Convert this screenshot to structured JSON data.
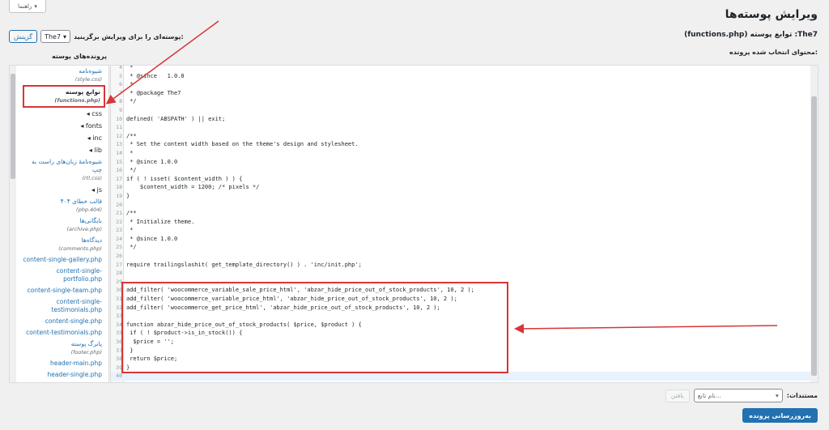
{
  "help_tab": {
    "label": "راهنما",
    "arrow": "▾"
  },
  "title": "ویرایش پوسته‌ها",
  "file_heading": {
    "theme": "The7",
    "rest": ": توابع پوسته (functions.php)"
  },
  "theme_select": {
    "label": "پوسته‌ای را برای ویرایش برگزینید:",
    "value": "The7",
    "button": "گزینش"
  },
  "selected_content_label": "محتوای انتخاب شده پرونده:",
  "files_heading": "پرونده‌های پوسته",
  "sidebar": [
    {
      "type": "file",
      "name": "شیوه‌نامه",
      "file": "(style.css)"
    },
    {
      "type": "file",
      "name": "توابع پوسته",
      "file": "(functions.php)",
      "active": true
    },
    {
      "type": "folder",
      "name": "css"
    },
    {
      "type": "folder",
      "name": "fonts"
    },
    {
      "type": "folder",
      "name": "inc"
    },
    {
      "type": "folder",
      "name": "lib"
    },
    {
      "type": "file",
      "name": "شیوه‌نامهٔ زبان‌های راست به چپ",
      "file": "(rtl.css)"
    },
    {
      "type": "folder",
      "name": "js"
    },
    {
      "type": "file",
      "name": "قالب خطای ۴۰۴",
      "file": "(php.404)"
    },
    {
      "type": "file",
      "name": "بایگانی‌ها",
      "file": "(archive.php)"
    },
    {
      "type": "file",
      "name": "دیدگاه‌ها",
      "file": "(comments.php)"
    },
    {
      "type": "file",
      "name": "content-single-gallery.php"
    },
    {
      "type": "file",
      "name": "content-single-portfolio.php"
    },
    {
      "type": "file",
      "name": "content-single-team.php"
    },
    {
      "type": "file",
      "name": "content-single-testimonials.php"
    },
    {
      "type": "file",
      "name": "content-single.php"
    },
    {
      "type": "file",
      "name": "content-testimonials.php"
    },
    {
      "type": "file",
      "name": "پانرگ پوسته",
      "file": "(footer.php)"
    },
    {
      "type": "file",
      "name": "header-main.php"
    },
    {
      "type": "file",
      "name": "header-single.php"
    }
  ],
  "code_lines": [
    {
      "n": "4",
      "t": " *",
      "c": "com"
    },
    {
      "n": "5",
      "t": " * @since   1.0.0",
      "c": "com"
    },
    {
      "n": "6",
      "t": " *",
      "c": "com"
    },
    {
      "n": "7",
      "t": " * @package The7",
      "c": "com"
    },
    {
      "n": "8",
      "t": " */",
      "c": "com"
    },
    {
      "n": "9",
      "t": "",
      "c": ""
    },
    {
      "n": "10",
      "t": "defined( 'ABSPATH' ) || exit;",
      "c": ""
    },
    {
      "n": "11",
      "t": "",
      "c": ""
    },
    {
      "n": "12",
      "t": "/**",
      "c": "com"
    },
    {
      "n": "13",
      "t": " * Set the content width based on the theme's design and stylesheet.",
      "c": "com"
    },
    {
      "n": "14",
      "t": " *",
      "c": "com"
    },
    {
      "n": "15",
      "t": " * @since 1.0.0",
      "c": "com"
    },
    {
      "n": "16",
      "t": " */",
      "c": "com"
    },
    {
      "n": "17",
      "t": "if ( ! isset( $content_width ) ) {",
      "c": ""
    },
    {
      "n": "18",
      "t": "    $content_width = 1200; /* pixels */",
      "c": "var"
    },
    {
      "n": "19",
      "t": "}",
      "c": ""
    },
    {
      "n": "20",
      "t": "",
      "c": ""
    },
    {
      "n": "21",
      "t": "/**",
      "c": "com"
    },
    {
      "n": "22",
      "t": " * Initialize theme.",
      "c": "com"
    },
    {
      "n": "23",
      "t": " *",
      "c": "com"
    },
    {
      "n": "24",
      "t": " * @since 1.0.0",
      "c": "com"
    },
    {
      "n": "25",
      "t": " */",
      "c": "com"
    },
    {
      "n": "26",
      "t": "",
      "c": ""
    },
    {
      "n": "27",
      "t": "require trailingslashit( get_template_directory() ) . 'inc/init.php';",
      "c": ""
    },
    {
      "n": "28",
      "t": "",
      "c": ""
    },
    {
      "n": "29",
      "t": "",
      "c": ""
    },
    {
      "n": "30",
      "t": "add_filter( 'woocommerce_variable_sale_price_html', 'abzar_hide_price_out_of_stock_products', 10, 2 );",
      "c": ""
    },
    {
      "n": "31",
      "t": "add_filter( 'woocommerce_variable_price_html', 'abzar_hide_price_out_of_stock_products', 10, 2 );",
      "c": ""
    },
    {
      "n": "32",
      "t": "add_filter( 'woocommerce_get_price_html', 'abzar_hide_price_out_of_stock_products', 10, 2 );",
      "c": ""
    },
    {
      "n": "33",
      "t": "",
      "c": ""
    },
    {
      "n": "34",
      "t": "function abzar_hide_price_out_of_stock_products( $price, $product ) {",
      "c": "kw"
    },
    {
      "n": "35",
      "t": " if ( ! $product->is_in_stock()) {",
      "c": ""
    },
    {
      "n": "36",
      "t": "  $price = '';",
      "c": "var"
    },
    {
      "n": "37",
      "t": " }",
      "c": ""
    },
    {
      "n": "38",
      "t": " return $price;",
      "c": ""
    },
    {
      "n": "39",
      "t": "}",
      "c": ""
    },
    {
      "n": "40",
      "t": "",
      "c": ""
    }
  ],
  "documentation": {
    "label": "مستندات:",
    "placeholder": "...نام تابع",
    "button": "یافتن"
  },
  "update_button": "به‌روزرسانی پرونده",
  "colors": {
    "accent": "#2271b1",
    "highlight": "#d63638"
  }
}
